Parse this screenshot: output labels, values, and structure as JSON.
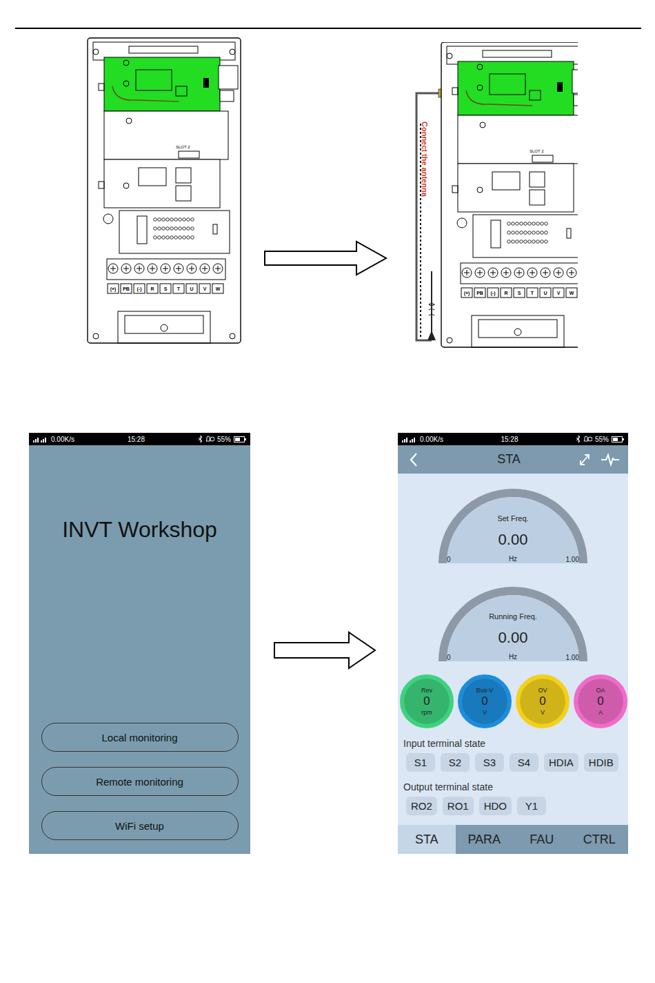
{
  "figures": [
    {
      "slot": "SLOT 2",
      "terminals": [
        "(+)",
        "PB",
        "(-)",
        "R",
        "S",
        "T",
        "U",
        "V",
        "W"
      ],
      "antenna": false
    },
    {
      "slot": "SLOT 2",
      "terminals": [
        "(+)",
        "PB",
        "(-)",
        "R",
        "S",
        "T",
        "U",
        "V",
        "W"
      ],
      "antenna": true,
      "antenna_label": "Connect the antenna"
    }
  ],
  "launch_screen": {
    "status_bar": {
      "speed": "0.00K/s",
      "time": "15:28",
      "battery": "55%"
    },
    "title": "INVT Workshop",
    "buttons": [
      "Local monitoring",
      "Remote monitoring",
      "WiFi setup"
    ]
  },
  "status_screen": {
    "status_bar": {
      "speed": "0.00K/s",
      "time": "15:28",
      "battery": "55%"
    },
    "header": {
      "title": "STA"
    },
    "gauges": [
      {
        "label": "Set Freq.",
        "value": "0.00",
        "unit": "Hz",
        "min": "0",
        "max": "1.00"
      },
      {
        "label": "Running Freq.",
        "value": "0.00",
        "unit": "Hz",
        "min": "0",
        "max": "1.00"
      }
    ],
    "meters": [
      {
        "label": "Rev",
        "value": "0",
        "unit": "rpm",
        "color": "#3ed27f"
      },
      {
        "label": "Bus-V",
        "value": "0",
        "unit": "V",
        "color": "#1d8ddb"
      },
      {
        "label": "OV",
        "value": "0",
        "unit": "V",
        "color": "#f2d11c"
      },
      {
        "label": "OA",
        "value": "0",
        "unit": "A",
        "color": "#f06cc8"
      }
    ],
    "input_title": "Input terminal state",
    "inputs": [
      "S1",
      "S2",
      "S3",
      "S4",
      "HDIA",
      "HDIB"
    ],
    "output_title": "Output terminal state",
    "outputs": [
      "RO2",
      "RO1",
      "HDO",
      "Y1"
    ],
    "tabs": [
      {
        "label": "STA",
        "selected": true
      },
      {
        "label": "PARA",
        "selected": false
      },
      {
        "label": "FAU",
        "selected": false
      },
      {
        "label": "CTRL",
        "selected": false
      }
    ]
  }
}
